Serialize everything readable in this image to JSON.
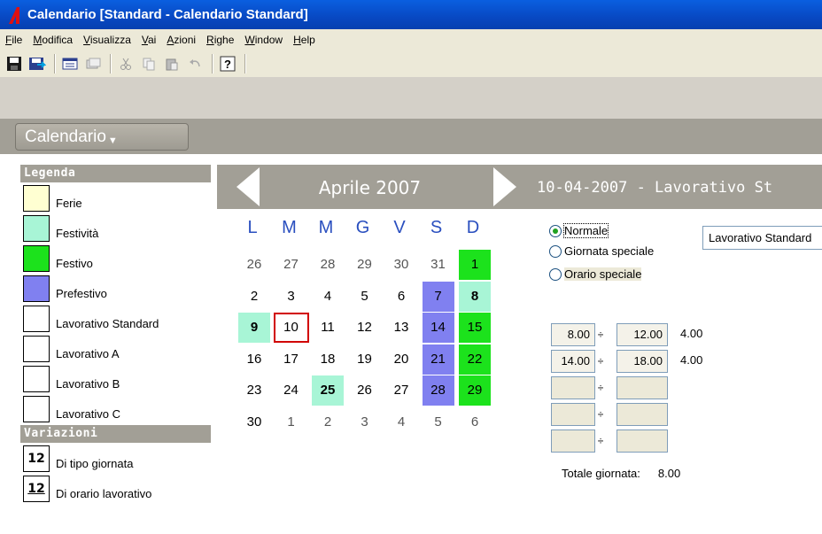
{
  "window": {
    "title": "Calendario [Standard - Calendario Standard]"
  },
  "menu": [
    {
      "label": "File",
      "ul": "F",
      "rest": "ile"
    },
    {
      "label": "Modifica",
      "ul": "M",
      "rest": "odifica"
    },
    {
      "label": "Visualizza",
      "ul": "V",
      "rest": "isualizza"
    },
    {
      "label": "Vai",
      "ul": "V",
      "rest": "ai"
    },
    {
      "label": "Azioni",
      "ul": "A",
      "rest": "zioni"
    },
    {
      "label": "Righe",
      "ul": "R",
      "rest": "ighe"
    },
    {
      "label": "Window",
      "ul": "W",
      "rest": "indow"
    },
    {
      "label": "Help",
      "ul": "H",
      "rest": "elp"
    }
  ],
  "mode": {
    "label": "Calendario"
  },
  "legend": {
    "title": "Legenda",
    "items": [
      {
        "label": "Ferie",
        "color": "#ffffd2"
      },
      {
        "label": "Festività",
        "color": "#a8f5d6"
      },
      {
        "label": "Festivo",
        "color": "#1ce21c"
      },
      {
        "label": "Prefestivo",
        "color": "#8080f0"
      },
      {
        "label": "Lavorativo Standard",
        "color": "#ffffff"
      },
      {
        "label": "Lavorativo A",
        "color": "#ffffff"
      },
      {
        "label": "Lavorativo B",
        "color": "#ffffff"
      },
      {
        "label": "Lavorativo C",
        "color": "#ffffff"
      }
    ]
  },
  "variations": {
    "title": "Variazioni",
    "items": [
      {
        "num": "12",
        "label": "Di tipo giornata",
        "underline": false
      },
      {
        "num": "12",
        "label": "Di orario lavorativo",
        "underline": true
      }
    ]
  },
  "calendar": {
    "month": "Aprile 2007",
    "weekdays": [
      "L",
      "M",
      "M",
      "G",
      "V",
      "S",
      "D"
    ],
    "weeks": [
      [
        {
          "d": "26",
          "o": true
        },
        {
          "d": "27",
          "o": true
        },
        {
          "d": "28",
          "o": true
        },
        {
          "d": "29",
          "o": true
        },
        {
          "d": "30",
          "o": true
        },
        {
          "d": "31",
          "o": true
        },
        {
          "d": "1",
          "bg": "#1ce21c"
        }
      ],
      [
        {
          "d": "2"
        },
        {
          "d": "3"
        },
        {
          "d": "4"
        },
        {
          "d": "5"
        },
        {
          "d": "6"
        },
        {
          "d": "7",
          "bg": "#8080f0"
        },
        {
          "d": "8",
          "bg": "#a8f5d6",
          "b": true
        }
      ],
      [
        {
          "d": "9",
          "bg": "#a8f5d6",
          "b": true
        },
        {
          "d": "10",
          "sel": true
        },
        {
          "d": "11"
        },
        {
          "d": "12"
        },
        {
          "d": "13"
        },
        {
          "d": "14",
          "bg": "#8080f0"
        },
        {
          "d": "15",
          "bg": "#1ce21c"
        }
      ],
      [
        {
          "d": "16"
        },
        {
          "d": "17"
        },
        {
          "d": "18"
        },
        {
          "d": "19"
        },
        {
          "d": "20"
        },
        {
          "d": "21",
          "bg": "#8080f0"
        },
        {
          "d": "22",
          "bg": "#1ce21c"
        }
      ],
      [
        {
          "d": "23"
        },
        {
          "d": "24"
        },
        {
          "d": "25",
          "bg": "#a8f5d6",
          "b": true
        },
        {
          "d": "26"
        },
        {
          "d": "27"
        },
        {
          "d": "28",
          "bg": "#8080f0"
        },
        {
          "d": "29",
          "bg": "#1ce21c"
        }
      ],
      [
        {
          "d": "30"
        },
        {
          "d": "1",
          "o": true
        },
        {
          "d": "2",
          "o": true
        },
        {
          "d": "3",
          "o": true
        },
        {
          "d": "4",
          "o": true
        },
        {
          "d": "5",
          "o": true
        },
        {
          "d": "6",
          "o": true
        }
      ]
    ]
  },
  "detail": {
    "title": "10-04-2007 - Lavorativo St",
    "radios": [
      {
        "label": "Normale",
        "checked": true
      },
      {
        "label": "Giornata speciale",
        "checked": false
      },
      {
        "label": "Orario speciale",
        "checked": false
      }
    ],
    "day_type": "Lavorativo Standard",
    "times": [
      {
        "from": "8.00",
        "to": "12.00",
        "dur": "4.00"
      },
      {
        "from": "14.00",
        "to": "18.00",
        "dur": "4.00"
      },
      {
        "from": "",
        "to": "",
        "dur": ""
      },
      {
        "from": "",
        "to": "",
        "dur": ""
      },
      {
        "from": "",
        "to": "",
        "dur": ""
      }
    ],
    "total_label": "Totale giornata:",
    "total_value": "8.00"
  }
}
